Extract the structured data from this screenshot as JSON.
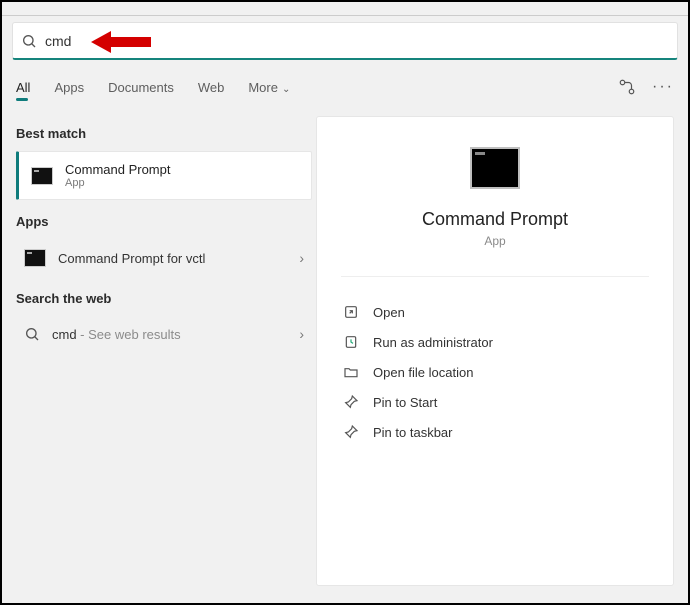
{
  "search": {
    "value": "cmd"
  },
  "tabs": {
    "items": [
      "All",
      "Apps",
      "Documents",
      "Web",
      "More"
    ],
    "active": 0
  },
  "left": {
    "best_match_heading": "Best match",
    "best": {
      "title": "Command Prompt",
      "subtitle": "App"
    },
    "apps_heading": "Apps",
    "apps": [
      {
        "label": "Command Prompt for vctl"
      }
    ],
    "web_heading": "Search the web",
    "web": {
      "term": "cmd",
      "suffix": " - See web results"
    }
  },
  "right": {
    "title": "Command Prompt",
    "subtitle": "App",
    "actions": {
      "open": "Open",
      "runadmin": "Run as administrator",
      "openloc": "Open file location",
      "pinstart": "Pin to Start",
      "pintask": "Pin to taskbar"
    }
  }
}
